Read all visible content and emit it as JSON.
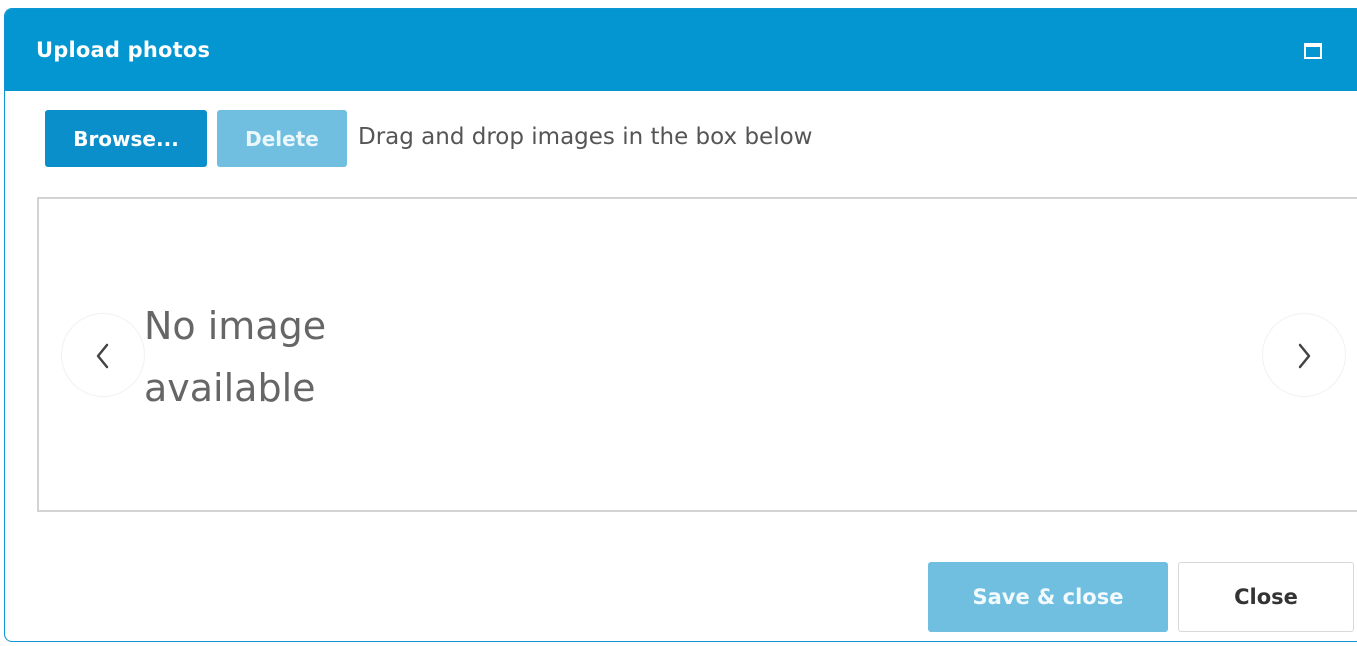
{
  "dialog": {
    "title": "Upload photos"
  },
  "toolbar": {
    "browse_label": "Browse...",
    "delete_label": "Delete",
    "hint": "Drag and drop images in the box below"
  },
  "gallery": {
    "empty_text": "No image available"
  },
  "footer": {
    "save_label": "Save & close",
    "close_label": "Close"
  },
  "icons": {
    "maximize": "maximize-icon",
    "previous": "chevron-left-icon",
    "next": "chevron-right-icon"
  },
  "colors": {
    "accent": "#0396d0",
    "button_primary": "#0a8fcb",
    "button_disabled": "#70bfe1"
  }
}
